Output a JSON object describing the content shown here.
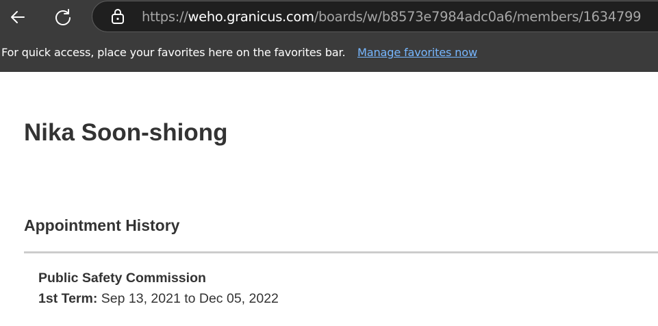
{
  "browser": {
    "url_prefix": "https://",
    "url_host": "weho.granicus.com",
    "url_path": "/boards/w/b8573e7984adc0a6/members/1634799",
    "favorites_message": "For quick access, place your favorites here on the favorites bar.",
    "favorites_link": "Manage favorites now",
    "icons": {
      "back": "back-arrow-icon",
      "refresh": "refresh-icon",
      "lock": "lock-icon"
    }
  },
  "page": {
    "member_name": "Nika Soon-shiong",
    "section_title": "Appointment History",
    "appointments": [
      {
        "board": "Public Safety Commission",
        "term_label": "1st Term:",
        "term_dates": "Sep 13, 2021 to Dec 05, 2022"
      }
    ]
  },
  "colors": {
    "chrome_bg": "#3b3b3b",
    "address_bg": "#1f1f1f",
    "link": "#77b7ff",
    "heading_text": "#333333",
    "divider": "#cccccc"
  }
}
